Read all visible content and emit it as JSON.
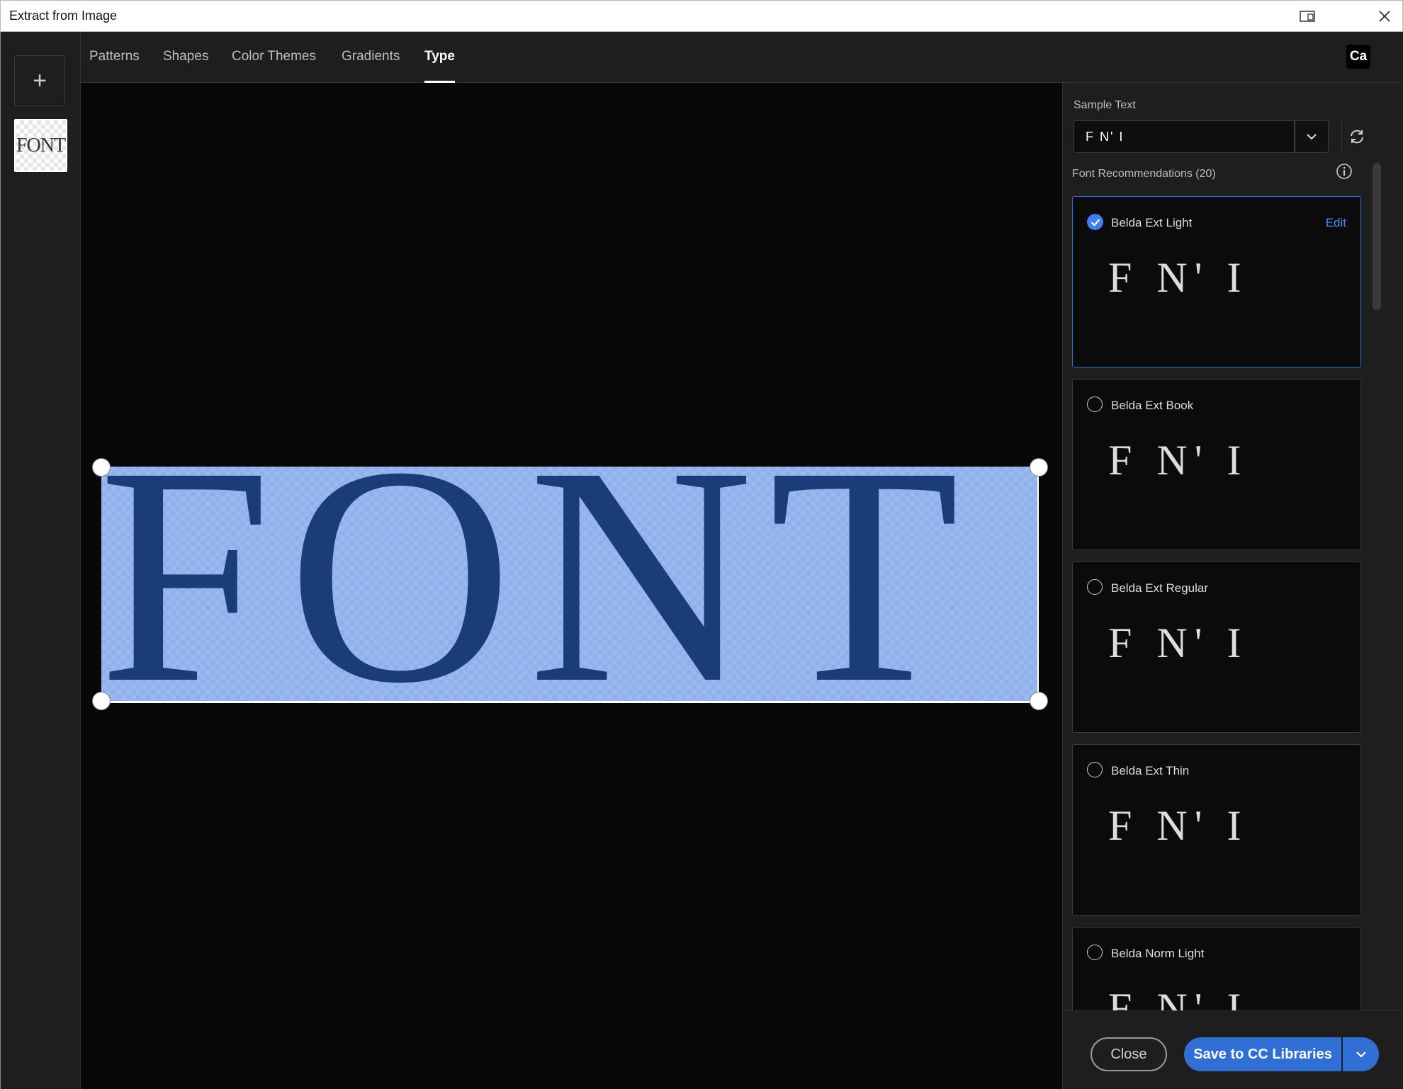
{
  "window": {
    "title": "Extract from Image"
  },
  "tabs": [
    {
      "label": "Patterns"
    },
    {
      "label": "Shapes"
    },
    {
      "label": "Color Themes"
    },
    {
      "label": "Gradients"
    },
    {
      "label": "Type"
    }
  ],
  "active_tab": "Type",
  "header": {
    "badge": "Ca"
  },
  "leftrail": {
    "add_label": "+",
    "thumbnail_text": "FONT"
  },
  "canvas": {
    "image_text": "FONT"
  },
  "panel": {
    "sample_label": "Sample Text",
    "sample_value": "F N' I",
    "recommendations_label": "Font Recommendations (20)",
    "edit_label": "Edit",
    "fonts": [
      {
        "name": "Belda Ext Light",
        "preview": "F N' I",
        "selected": true
      },
      {
        "name": "Belda Ext Book",
        "preview": "F N' I",
        "selected": false
      },
      {
        "name": "Belda Ext Regular",
        "preview": "F N' I",
        "selected": false
      },
      {
        "name": "Belda Ext Thin",
        "preview": "F N' I",
        "selected": false
      },
      {
        "name": "Belda Norm Light",
        "preview": "F N' I",
        "selected": false
      }
    ]
  },
  "footer": {
    "close_label": "Close",
    "save_label": "Save to CC Libraries"
  },
  "colors": {
    "accent": "#2f6fd6",
    "selection": "#9bb8ee",
    "glyph": "#1a3c78"
  },
  "icons": [
    "snap-layout-icon",
    "close-icon",
    "plus-icon",
    "chevron-down-icon",
    "refresh-icon",
    "info-icon",
    "check-icon"
  ]
}
